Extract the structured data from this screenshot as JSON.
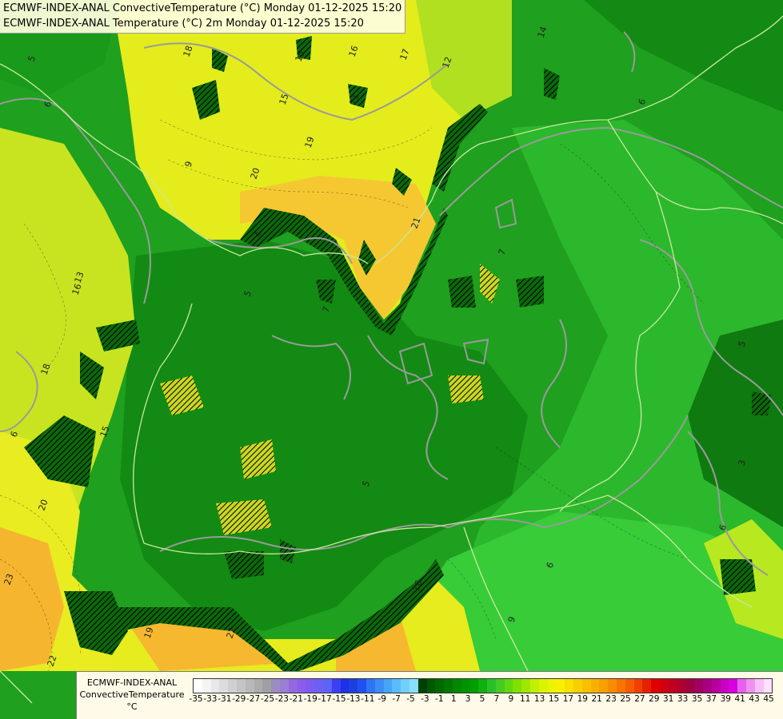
{
  "title_lines": [
    "ECMWF-INDEX-ANAL ConvectiveTemperature (°C) Monday 01-12-2025 15:20",
    "ECMWF-INDEX-ANAL Temperature (°C) 2m Monday 01-12-2025 15:20"
  ],
  "legend": {
    "label_line1": "ECMWF-INDEX-ANAL",
    "label_line2": "ConvectiveTemperature",
    "label_line3": "°C",
    "ticks": [
      "-35",
      "-33",
      "-31",
      "-29",
      "-27",
      "-25",
      "-23",
      "-21",
      "-19",
      "-17",
      "-15",
      "-13",
      "-11",
      "-9",
      "-7",
      "-5",
      "-3",
      "-1",
      "1",
      "3",
      "5",
      "7",
      "9",
      "11",
      "13",
      "15",
      "17",
      "19",
      "21",
      "23",
      "25",
      "27",
      "29",
      "31",
      "33",
      "35",
      "37",
      "39",
      "41",
      "43",
      "45"
    ],
    "colors": [
      "#ffffff",
      "#f4f4f4",
      "#e8e8e8",
      "#dcdcdc",
      "#d0d0d0",
      "#c4c4c4",
      "#b8b8b8",
      "#acacac",
      "#a0a0a0",
      "#9c8cc0",
      "#9a7ed4",
      "#9468e0",
      "#8c5cec",
      "#7c5cf0",
      "#6c60f4",
      "#5c64f8",
      "#3c40f4",
      "#2030e8",
      "#1c40e0",
      "#2050f0",
      "#2f74f4",
      "#3c8cf8",
      "#48a4f8",
      "#58bcfc",
      "#70d0fc",
      "#88e0fc",
      "#004000",
      "#005800",
      "#006800",
      "#007800",
      "#008800",
      "#009400",
      "#00a000",
      "#10b010",
      "#28c028",
      "#44cc20",
      "#60d810",
      "#80e000",
      "#a0e800",
      "#c0f000",
      "#d8f400",
      "#ecf400",
      "#f8f000",
      "#f8e000",
      "#f8d000",
      "#f8c000",
      "#f8b000",
      "#f8a000",
      "#f88c00",
      "#f87400",
      "#f85c00",
      "#f04000",
      "#e82000",
      "#e00000",
      "#d00010",
      "#c00020",
      "#b00030",
      "#a00040",
      "#a00060",
      "#a80080",
      "#b800a0",
      "#c800c0",
      "#d800e0",
      "#e860f0",
      "#f090f0",
      "#f8c0f8",
      "#ffe0ff"
    ]
  },
  "contour_labels": [
    "5",
    "6",
    "18",
    "15",
    "16",
    "17",
    "12",
    "14",
    "19",
    "20",
    "21",
    "4",
    "5",
    "16",
    "18",
    "6",
    "15",
    "21",
    "7",
    "20",
    "23",
    "22",
    "19",
    "5",
    "6",
    "6",
    "9",
    "16",
    "3",
    "22",
    "13",
    "5",
    "7",
    "6",
    "15",
    "9"
  ],
  "colors": {
    "green_dark": "#0a8a0a",
    "green_mid": "#23a023",
    "green_light": "#3bc43b",
    "yellow": "#e8ee18",
    "yellow_green": "#b8e818",
    "orange": "#f8c030",
    "title_bg": "#ffffe0"
  }
}
